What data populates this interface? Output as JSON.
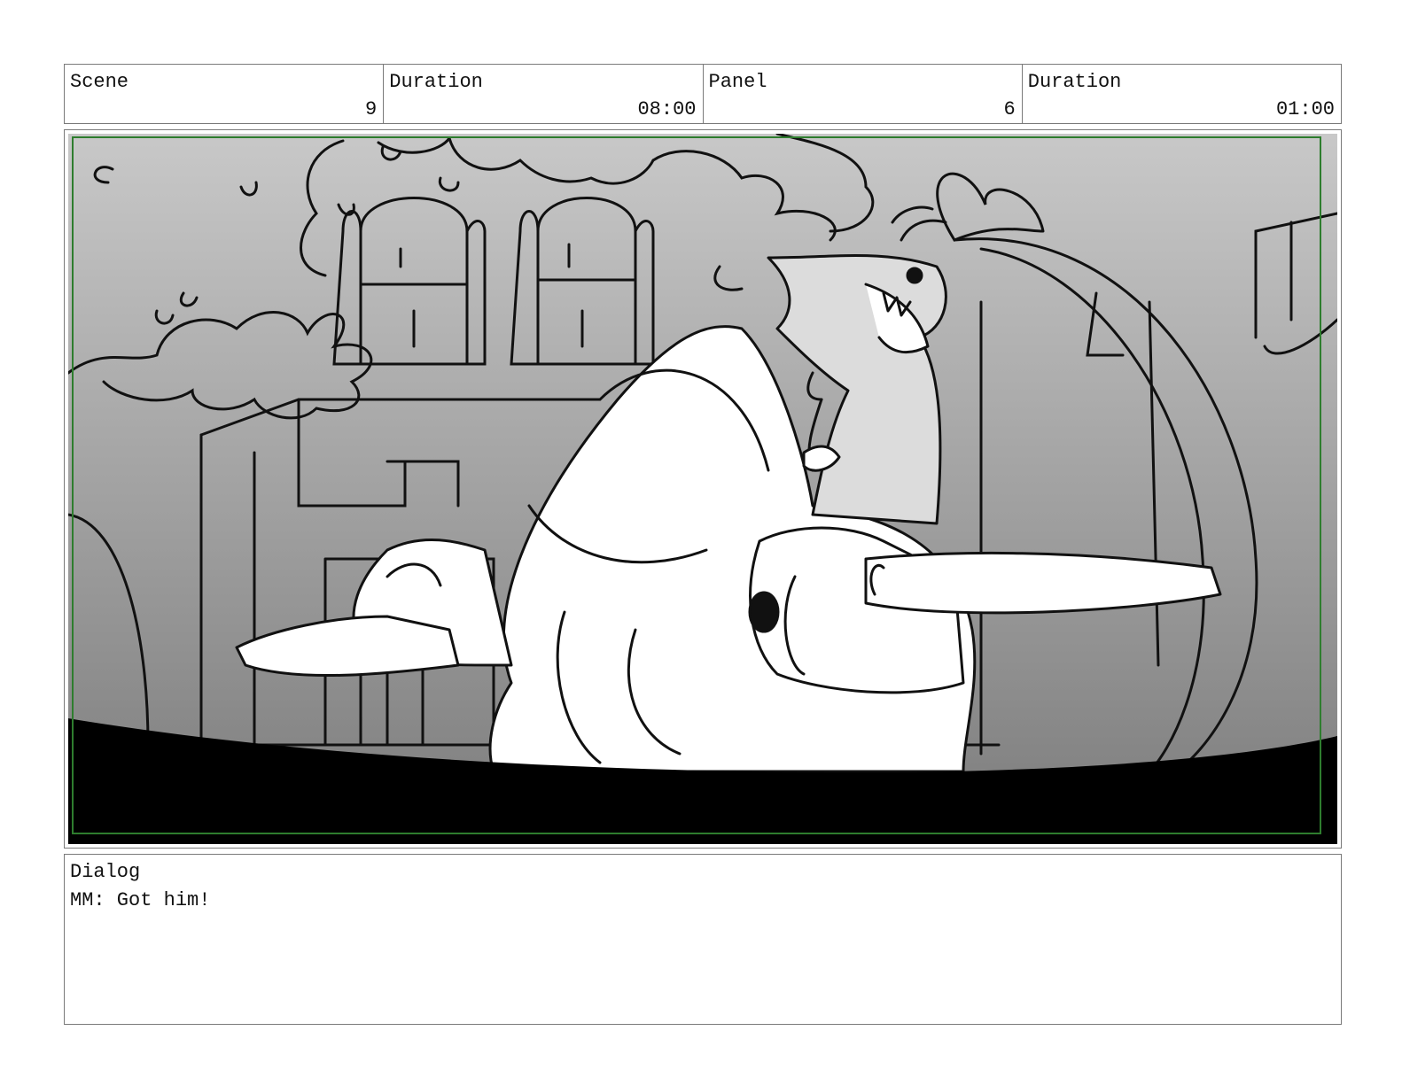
{
  "header": {
    "scene_label": "Scene",
    "scene_value": "9",
    "scene_duration_label": "Duration",
    "scene_duration_value": "08:00",
    "panel_label": "Panel",
    "panel_value": "6",
    "panel_duration_label": "Duration",
    "panel_duration_value": "01:00"
  },
  "panel": {
    "safe_frame_color": "#2e7d2e"
  },
  "dialog": {
    "label": "Dialog",
    "text": "MM: Got him!"
  }
}
